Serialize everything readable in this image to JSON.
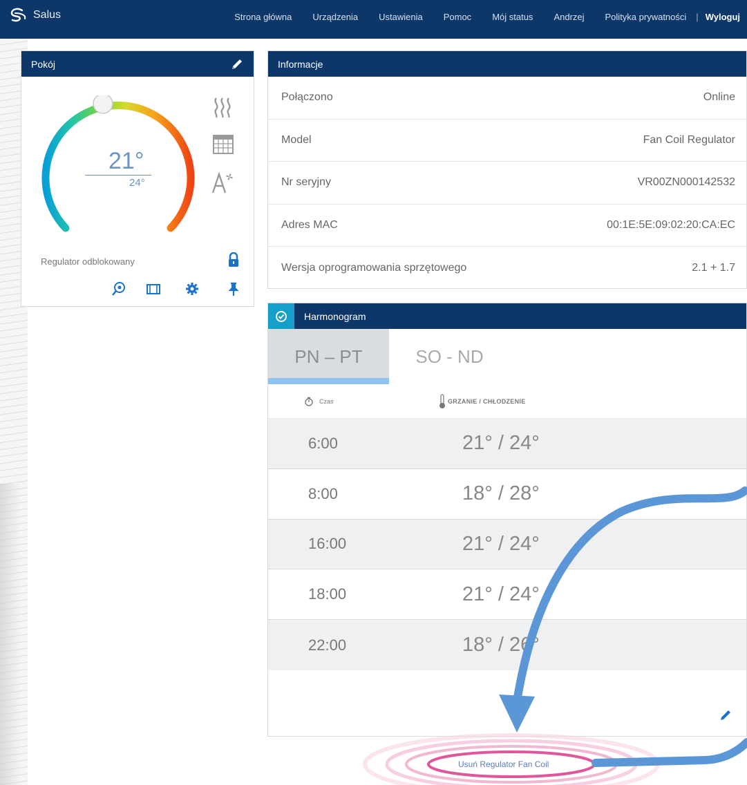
{
  "app": {
    "name": "Salus"
  },
  "nav": {
    "items": [
      "Strona główna",
      "Urządzenia",
      "Ustawienia",
      "Pomoc",
      "Mój status",
      "Andrzej",
      "Polityka prywatności"
    ],
    "separator": "|",
    "logout": "Wyloguj"
  },
  "room": {
    "title": "Pokój",
    "temp_current": "21°",
    "temp_set": "24°",
    "status": "Regulator odblokowany"
  },
  "info": {
    "title": "Informacje",
    "rows": [
      {
        "label": "Połączono",
        "value": "Online"
      },
      {
        "label": "Model",
        "value": "Fan Coil Regulator"
      },
      {
        "label": "Nr seryjny",
        "value": "VR00ZN000142532"
      },
      {
        "label": "Adres MAC",
        "value": "00:1E:5E:09:02:20:CA:EC"
      },
      {
        "label": "Wersja oprogramowania sprzętowego",
        "value": "2.1 + 1.7"
      }
    ]
  },
  "schedule": {
    "title": "Harmonogram",
    "tabs": [
      "PN – PT",
      "SO - ND"
    ],
    "col_time": "Czas",
    "col_temp": "GRZANIE / CHŁODZENIE",
    "rows": [
      {
        "time": "6:00",
        "temps": "21° / 24°"
      },
      {
        "time": "8:00",
        "temps": "18° / 28°"
      },
      {
        "time": "16:00",
        "temps": "21° / 24°"
      },
      {
        "time": "18:00",
        "temps": "21° / 24°"
      },
      {
        "time": "22:00",
        "temps": "18° / 26°"
      }
    ]
  },
  "remove_link": "Usuń Regulator Fan Coil",
  "colors": {
    "nav_bg": "#0d3768",
    "accent": "#1a73c8",
    "highlight": "#e0569b",
    "arrow": "#5b96d6"
  }
}
